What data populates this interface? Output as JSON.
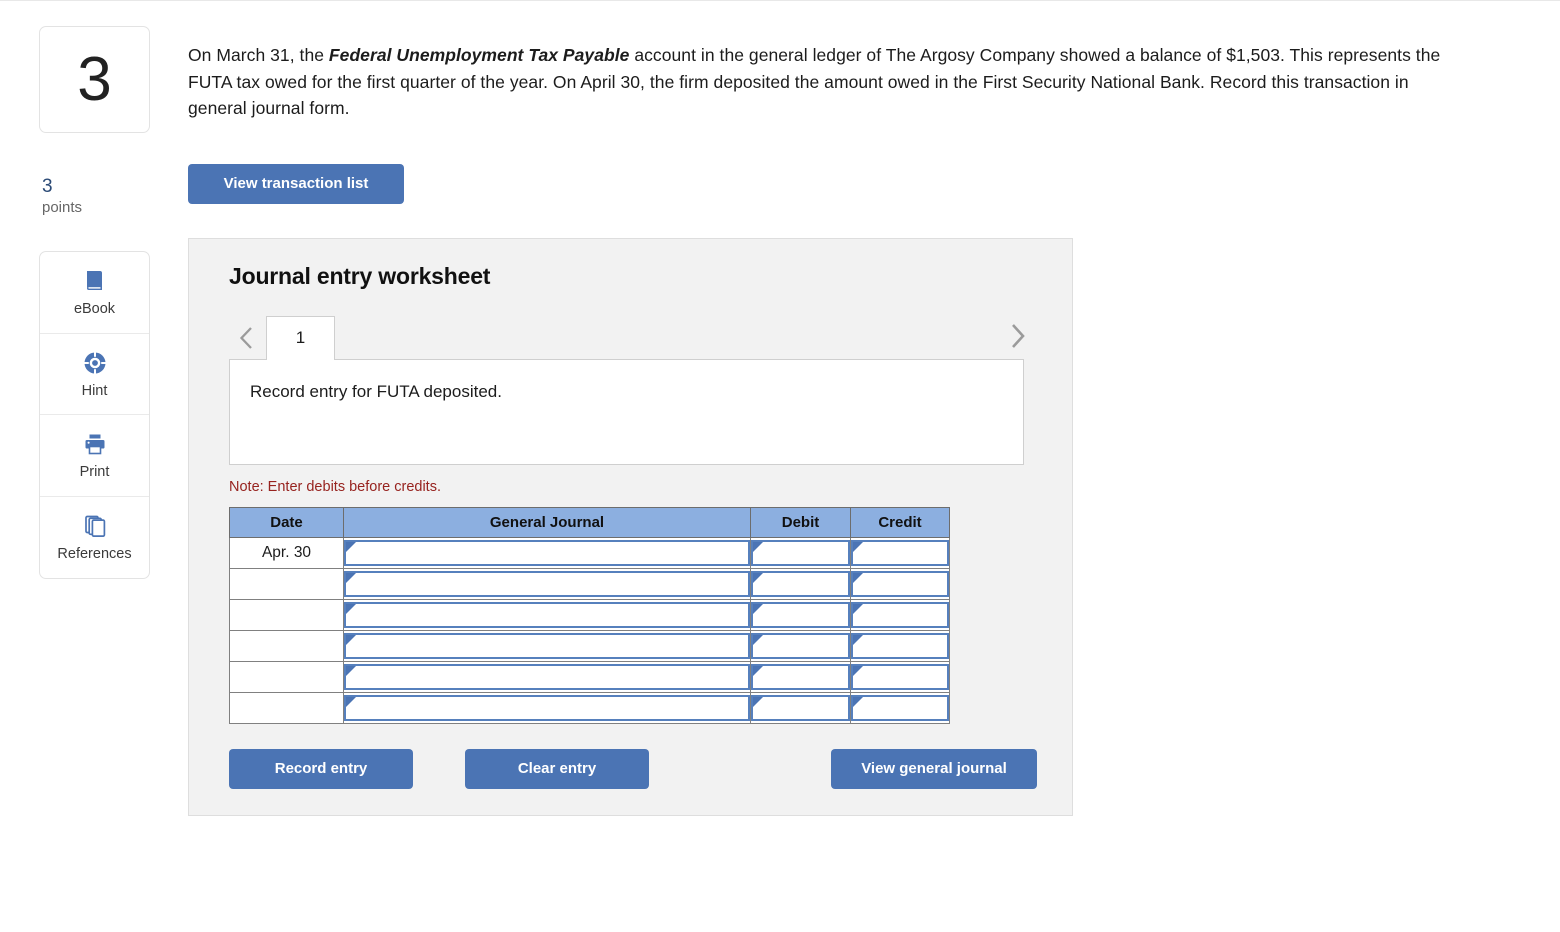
{
  "question": {
    "number": "3",
    "points_value": "3",
    "points_label": "points",
    "text_part1": "On March 31, the ",
    "text_bold": "Federal Unemployment Tax Payable",
    "text_part2": " account in the general ledger of The Argosy Company showed a balance of $1,503. This represents the FUTA tax owed for the first quarter of the year. On April 30, the firm deposited the amount owed in the First Security National Bank. Record this transaction in general journal form."
  },
  "tools": [
    {
      "label": "eBook",
      "icon": "book-icon"
    },
    {
      "label": "Hint",
      "icon": "lifering-icon"
    },
    {
      "label": "Print",
      "icon": "printer-icon"
    },
    {
      "label": "References",
      "icon": "copy-pages-icon"
    }
  ],
  "toolbar": {
    "view_transaction_list": "View transaction list"
  },
  "worksheet": {
    "title": "Journal entry worksheet",
    "prev_arrow": "chevron-left-icon",
    "next_arrow": "chevron-right-icon",
    "tabs": [
      {
        "label": "1",
        "active": true
      }
    ],
    "description": "Record entry for FUTA deposited.",
    "note": "Note: Enter debits before credits.",
    "table": {
      "headers": [
        "Date",
        "General Journal",
        "Debit",
        "Credit"
      ],
      "rows": [
        {
          "date": "Apr. 30",
          "general_journal": "",
          "debit": "",
          "credit": ""
        },
        {
          "date": "",
          "general_journal": "",
          "debit": "",
          "credit": ""
        },
        {
          "date": "",
          "general_journal": "",
          "debit": "",
          "credit": ""
        },
        {
          "date": "",
          "general_journal": "",
          "debit": "",
          "credit": ""
        },
        {
          "date": "",
          "general_journal": "",
          "debit": "",
          "credit": ""
        },
        {
          "date": "",
          "general_journal": "",
          "debit": "",
          "credit": ""
        }
      ]
    },
    "buttons": {
      "record_entry": "Record entry",
      "clear_entry": "Clear entry",
      "view_general_journal": "View general journal"
    }
  },
  "colors": {
    "button_blue": "#4b74b4",
    "table_header_blue": "#8cafe0",
    "input_border_blue": "#5680bd",
    "note_red": "#97231f",
    "points_blue": "#2b4a76",
    "panel_bg": "#f2f2f2"
  }
}
